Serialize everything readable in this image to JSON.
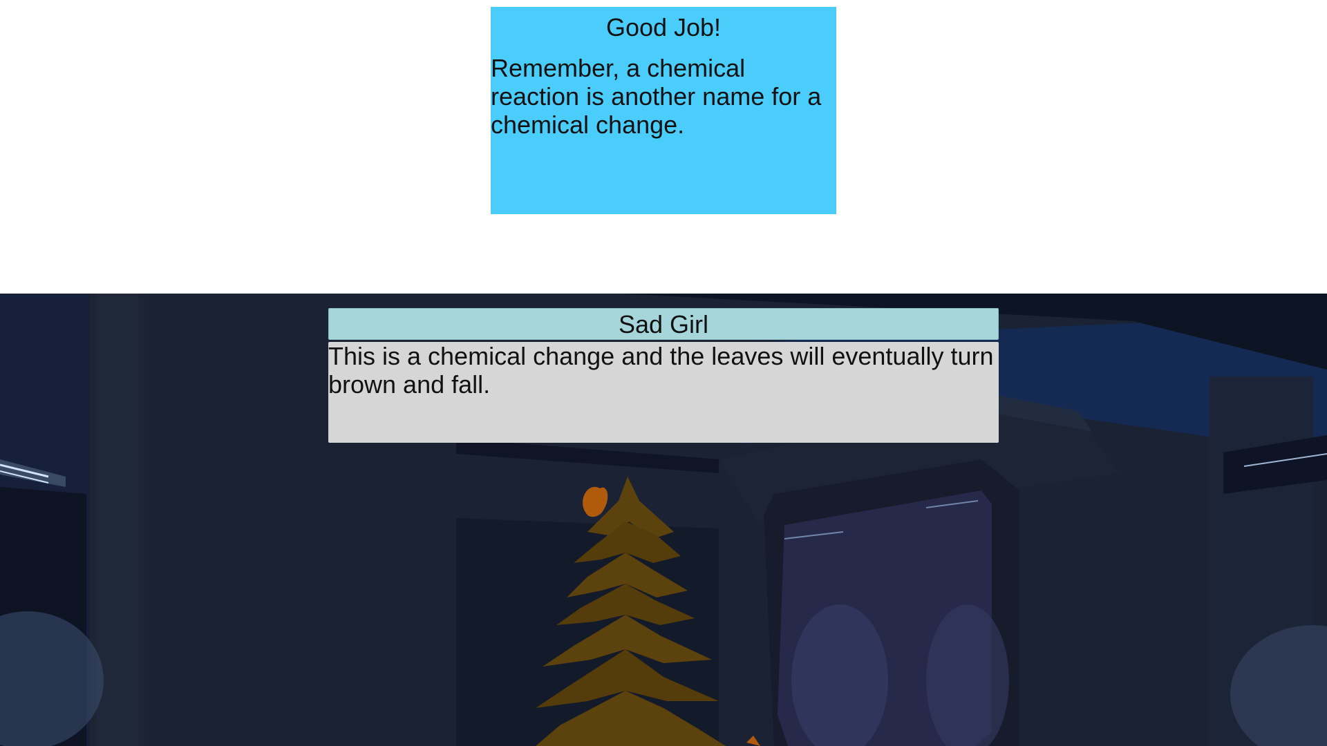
{
  "feedback": {
    "title": "Good Job!",
    "message": "Remember, a chemical reaction is another name for a chemical change."
  },
  "dialogue": {
    "speaker": "Sad Girl",
    "text": "This is a chemical change and the leaves will eventually turn brown and fall."
  },
  "scene": {
    "objects": [
      "pine-tree",
      "falling-leaf",
      "window",
      "ceiling-beam"
    ],
    "colors": {
      "wall": "#1a2233",
      "ceiling": "#132a52",
      "tree": "#5c420c",
      "leaf": "#b05a0c",
      "popup": "#4bcdfc",
      "speaker_bar": "#a6d6d9",
      "dialogue_body": "#d6d6d6"
    }
  }
}
